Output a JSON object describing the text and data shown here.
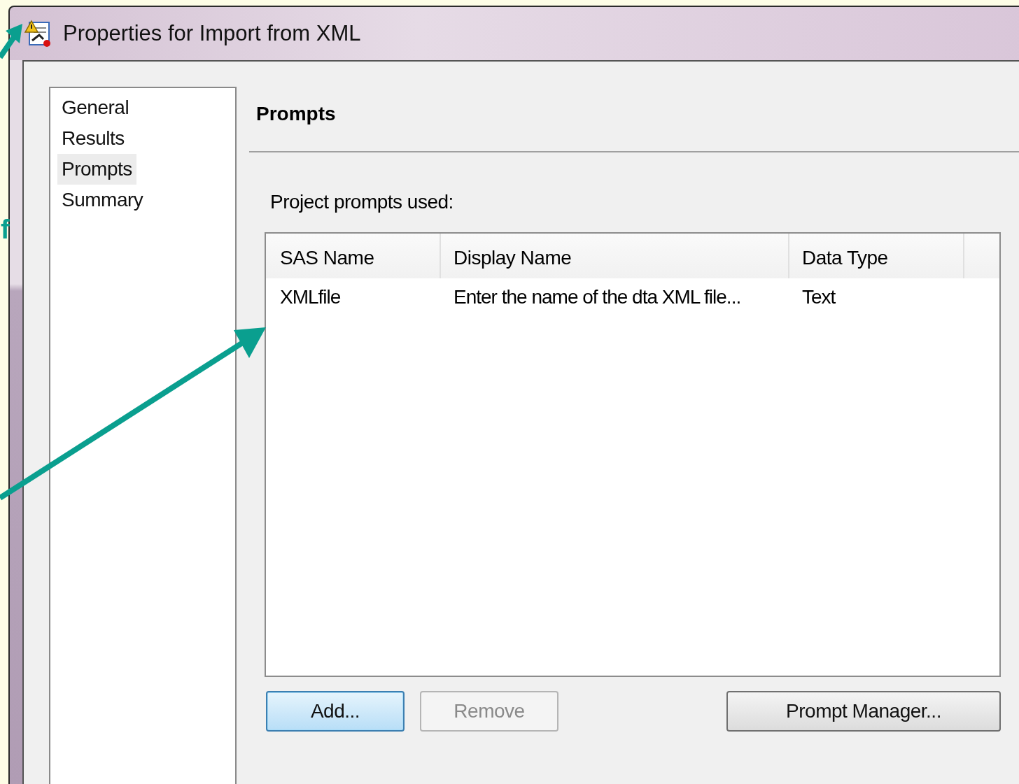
{
  "window": {
    "title": "Properties for Import from XML"
  },
  "sidebar": {
    "items": [
      {
        "label": "General",
        "selected": false
      },
      {
        "label": "Results",
        "selected": false
      },
      {
        "label": "Prompts",
        "selected": true
      },
      {
        "label": "Summary",
        "selected": false
      }
    ]
  },
  "page": {
    "heading": "Prompts",
    "label": "Project prompts used:"
  },
  "table": {
    "columns": [
      "SAS Name",
      "Display Name",
      "Data Type"
    ],
    "rows": [
      [
        "XMLfile",
        "Enter the name of the dta XML file...",
        "Text"
      ]
    ]
  },
  "buttons": [
    {
      "label": "Add...",
      "default": true,
      "disabled": false
    },
    {
      "label": "Remove",
      "default": false,
      "disabled": true
    },
    {
      "label": "Prompt Manager...",
      "default": false,
      "disabled": false
    }
  ],
  "annotation": {
    "text": "f"
  }
}
